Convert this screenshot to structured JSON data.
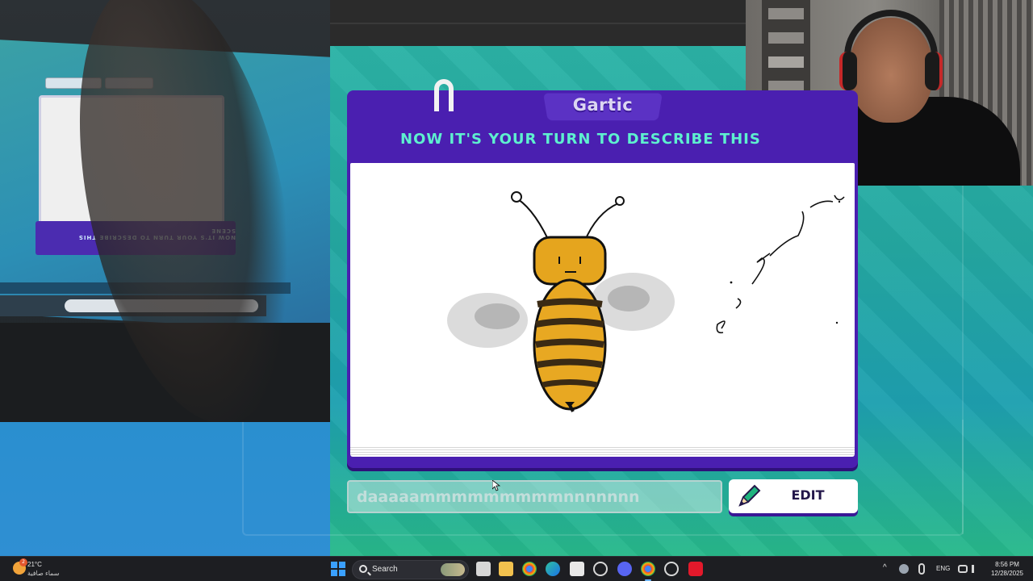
{
  "game": {
    "logo": "Gartic",
    "heading": "NOW IT'S YOUR TURN TO DESCRIBE THIS",
    "answer_value": "daaaaammmmmmmmmnnnnnnn",
    "edit_label": "EDIT",
    "accent_color": "#4a1fb0",
    "heading_color": "#5ef0cf"
  },
  "taskbar": {
    "weather_temp": "21°C",
    "weather_condition": "سماء صافية",
    "weather_badge": "2",
    "search_label": "Search",
    "language": "ENG",
    "time": "8:56 PM",
    "date": "12/28/2025",
    "icons": [
      "start-icon",
      "search-icon",
      "task-view-icon",
      "file-explorer-icon",
      "chrome-icon",
      "edge-icon",
      "store-icon",
      "app-icon",
      "discord-icon",
      "chrome-active-icon",
      "settings-icon",
      "recorder-icon"
    ]
  }
}
